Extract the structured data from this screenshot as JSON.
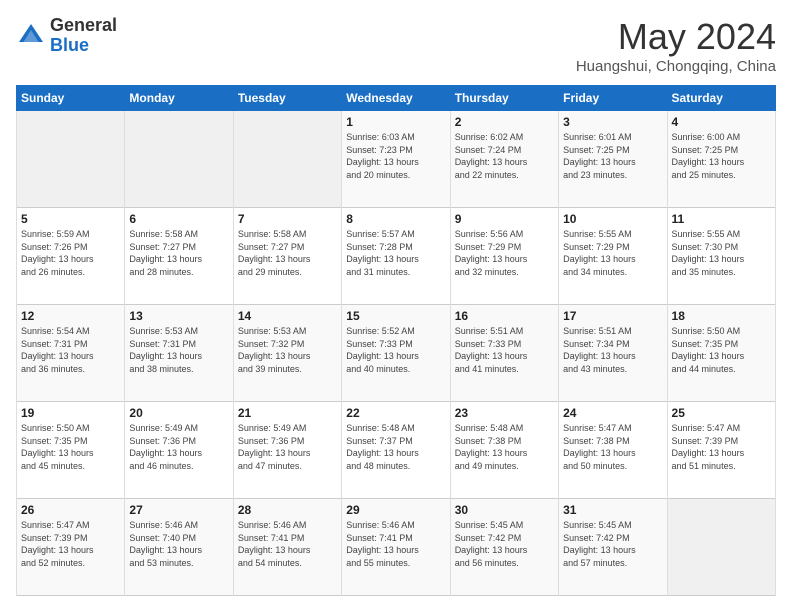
{
  "logo": {
    "general": "General",
    "blue": "Blue"
  },
  "title": "May 2024",
  "location": "Huangshui, Chongqing, China",
  "days_of_week": [
    "Sunday",
    "Monday",
    "Tuesday",
    "Wednesday",
    "Thursday",
    "Friday",
    "Saturday"
  ],
  "weeks": [
    [
      {
        "day": "",
        "info": ""
      },
      {
        "day": "",
        "info": ""
      },
      {
        "day": "",
        "info": ""
      },
      {
        "day": "1",
        "info": "Sunrise: 6:03 AM\nSunset: 7:23 PM\nDaylight: 13 hours\nand 20 minutes."
      },
      {
        "day": "2",
        "info": "Sunrise: 6:02 AM\nSunset: 7:24 PM\nDaylight: 13 hours\nand 22 minutes."
      },
      {
        "day": "3",
        "info": "Sunrise: 6:01 AM\nSunset: 7:25 PM\nDaylight: 13 hours\nand 23 minutes."
      },
      {
        "day": "4",
        "info": "Sunrise: 6:00 AM\nSunset: 7:25 PM\nDaylight: 13 hours\nand 25 minutes."
      }
    ],
    [
      {
        "day": "5",
        "info": "Sunrise: 5:59 AM\nSunset: 7:26 PM\nDaylight: 13 hours\nand 26 minutes."
      },
      {
        "day": "6",
        "info": "Sunrise: 5:58 AM\nSunset: 7:27 PM\nDaylight: 13 hours\nand 28 minutes."
      },
      {
        "day": "7",
        "info": "Sunrise: 5:58 AM\nSunset: 7:27 PM\nDaylight: 13 hours\nand 29 minutes."
      },
      {
        "day": "8",
        "info": "Sunrise: 5:57 AM\nSunset: 7:28 PM\nDaylight: 13 hours\nand 31 minutes."
      },
      {
        "day": "9",
        "info": "Sunrise: 5:56 AM\nSunset: 7:29 PM\nDaylight: 13 hours\nand 32 minutes."
      },
      {
        "day": "10",
        "info": "Sunrise: 5:55 AM\nSunset: 7:29 PM\nDaylight: 13 hours\nand 34 minutes."
      },
      {
        "day": "11",
        "info": "Sunrise: 5:55 AM\nSunset: 7:30 PM\nDaylight: 13 hours\nand 35 minutes."
      }
    ],
    [
      {
        "day": "12",
        "info": "Sunrise: 5:54 AM\nSunset: 7:31 PM\nDaylight: 13 hours\nand 36 minutes."
      },
      {
        "day": "13",
        "info": "Sunrise: 5:53 AM\nSunset: 7:31 PM\nDaylight: 13 hours\nand 38 minutes."
      },
      {
        "day": "14",
        "info": "Sunrise: 5:53 AM\nSunset: 7:32 PM\nDaylight: 13 hours\nand 39 minutes."
      },
      {
        "day": "15",
        "info": "Sunrise: 5:52 AM\nSunset: 7:33 PM\nDaylight: 13 hours\nand 40 minutes."
      },
      {
        "day": "16",
        "info": "Sunrise: 5:51 AM\nSunset: 7:33 PM\nDaylight: 13 hours\nand 41 minutes."
      },
      {
        "day": "17",
        "info": "Sunrise: 5:51 AM\nSunset: 7:34 PM\nDaylight: 13 hours\nand 43 minutes."
      },
      {
        "day": "18",
        "info": "Sunrise: 5:50 AM\nSunset: 7:35 PM\nDaylight: 13 hours\nand 44 minutes."
      }
    ],
    [
      {
        "day": "19",
        "info": "Sunrise: 5:50 AM\nSunset: 7:35 PM\nDaylight: 13 hours\nand 45 minutes."
      },
      {
        "day": "20",
        "info": "Sunrise: 5:49 AM\nSunset: 7:36 PM\nDaylight: 13 hours\nand 46 minutes."
      },
      {
        "day": "21",
        "info": "Sunrise: 5:49 AM\nSunset: 7:36 PM\nDaylight: 13 hours\nand 47 minutes."
      },
      {
        "day": "22",
        "info": "Sunrise: 5:48 AM\nSunset: 7:37 PM\nDaylight: 13 hours\nand 48 minutes."
      },
      {
        "day": "23",
        "info": "Sunrise: 5:48 AM\nSunset: 7:38 PM\nDaylight: 13 hours\nand 49 minutes."
      },
      {
        "day": "24",
        "info": "Sunrise: 5:47 AM\nSunset: 7:38 PM\nDaylight: 13 hours\nand 50 minutes."
      },
      {
        "day": "25",
        "info": "Sunrise: 5:47 AM\nSunset: 7:39 PM\nDaylight: 13 hours\nand 51 minutes."
      }
    ],
    [
      {
        "day": "26",
        "info": "Sunrise: 5:47 AM\nSunset: 7:39 PM\nDaylight: 13 hours\nand 52 minutes."
      },
      {
        "day": "27",
        "info": "Sunrise: 5:46 AM\nSunset: 7:40 PM\nDaylight: 13 hours\nand 53 minutes."
      },
      {
        "day": "28",
        "info": "Sunrise: 5:46 AM\nSunset: 7:41 PM\nDaylight: 13 hours\nand 54 minutes."
      },
      {
        "day": "29",
        "info": "Sunrise: 5:46 AM\nSunset: 7:41 PM\nDaylight: 13 hours\nand 55 minutes."
      },
      {
        "day": "30",
        "info": "Sunrise: 5:45 AM\nSunset: 7:42 PM\nDaylight: 13 hours\nand 56 minutes."
      },
      {
        "day": "31",
        "info": "Sunrise: 5:45 AM\nSunset: 7:42 PM\nDaylight: 13 hours\nand 57 minutes."
      },
      {
        "day": "",
        "info": ""
      }
    ]
  ]
}
